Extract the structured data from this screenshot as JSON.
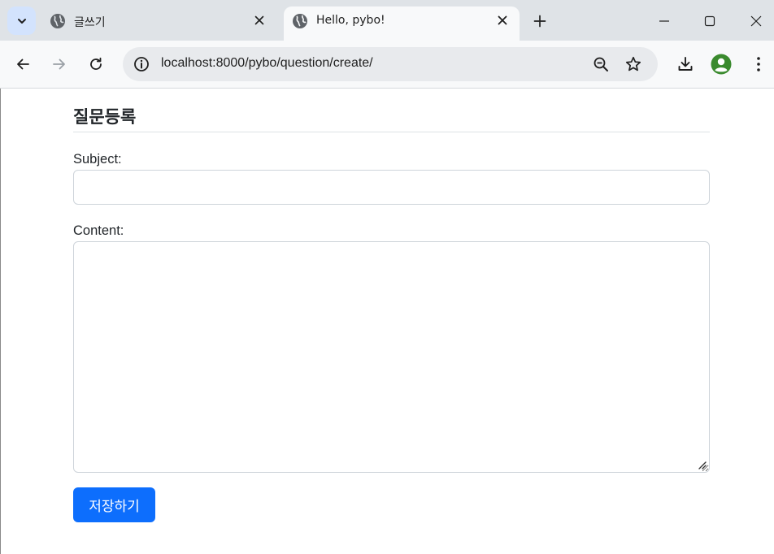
{
  "browser": {
    "tabs": [
      {
        "title": "글쓰기",
        "active": false
      },
      {
        "title": "Hello, pybo!",
        "active": true
      }
    ],
    "url": "localhost:8000/pybo/question/create/",
    "colors": {
      "tabstrip": "#dfe3e7",
      "toolbar": "#f8f9fa",
      "omnibox": "#e8eaed",
      "profile": "#3a8a2e"
    }
  },
  "page": {
    "title": "질문등록",
    "subject_label": "Subject:",
    "subject_value": "",
    "content_label": "Content:",
    "content_value": "",
    "save_label": "저장하기",
    "colors": {
      "primary": "#0d6efd",
      "border": "#ced4da"
    }
  }
}
